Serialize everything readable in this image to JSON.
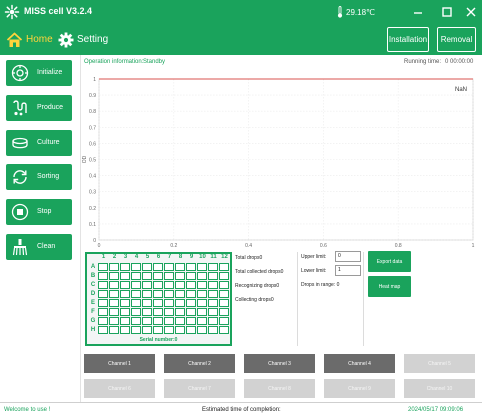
{
  "titlebar": {
    "app_name": "MISS cell",
    "version": "V3.2.4",
    "temperature": "29.18℃",
    "icons": [
      "app-logo-icon",
      "thermometer-icon",
      "minimize-icon",
      "maximize-icon",
      "close-icon"
    ]
  },
  "menubar": {
    "home_label": "Home",
    "setting_label": "Setting",
    "installation_label": "Installation",
    "removal_label": "Removal"
  },
  "sidebar": {
    "items": [
      {
        "label": "Initialize",
        "icon": "gear-icon"
      },
      {
        "label": "Produce",
        "icon": "droplet-icon"
      },
      {
        "label": "Culture",
        "icon": "dish-icon"
      },
      {
        "label": "Sorting",
        "icon": "sync-icon"
      },
      {
        "label": "Stop",
        "icon": "stop-icon"
      },
      {
        "label": "Clean",
        "icon": "brush-icon"
      }
    ]
  },
  "status": {
    "operation_label": "Operation information:",
    "operation_value": "Standby",
    "running_label": "Running time:",
    "running_value": "0 00:00:00"
  },
  "chart_data": {
    "type": "line",
    "title": "",
    "xlabel": "",
    "ylabel": "OD",
    "xlim": [
      0,
      1
    ],
    "ylim": [
      0,
      1
    ],
    "x_ticks": [
      "0",
      "0.2",
      "0.4",
      "0.6",
      "0.8",
      "1"
    ],
    "y_ticks": [
      "0",
      "0.1",
      "0.2",
      "0.3",
      "0.4",
      "0.5",
      "0.6",
      "0.7",
      "0.8",
      "0.9",
      "1"
    ],
    "reference_line": {
      "y": 1,
      "color": "#d9534f"
    },
    "annotation": "NaN",
    "grid": true,
    "series": []
  },
  "plate": {
    "columns": [
      "1",
      "2",
      "3",
      "4",
      "5",
      "6",
      "7",
      "8",
      "9",
      "10",
      "11",
      "12"
    ],
    "rows": [
      "A",
      "B",
      "C",
      "D",
      "E",
      "F",
      "G",
      "H"
    ],
    "serial_label": "Serial number:0"
  },
  "counters": {
    "total_drops": "Total drops0",
    "total_collected": "Total collected drops0",
    "recognizing": "Recognizing drops0",
    "collecting": "Collecting drops0"
  },
  "limits": {
    "upper_label": "Upper limit:",
    "upper_value": "0",
    "lower_label": "Lower limit:",
    "lower_value": "1",
    "drops_in_range": "Drops in range:  0"
  },
  "actions": {
    "export_label": "Export data",
    "heatmap_label": "Heat map"
  },
  "channels": {
    "row1": [
      "Channel 1",
      "Channel 2",
      "Channel 3",
      "Channel 4",
      "Channel 5"
    ],
    "row2": [
      "Channel 6",
      "Channel 7",
      "Channel 8",
      "Channel 9",
      "Channel 10"
    ]
  },
  "footer": {
    "welcome": "Welcome to use !",
    "estimated": "Estimated time of completion:",
    "datetime": "2024/05/17 09:09:06"
  },
  "colors": {
    "brand": "#1aa35c",
    "home_accent": "#ffd43b",
    "reference_line": "#d9534f",
    "channel_active": "#6b6b6b",
    "channel_disabled": "#d2d2d2"
  }
}
